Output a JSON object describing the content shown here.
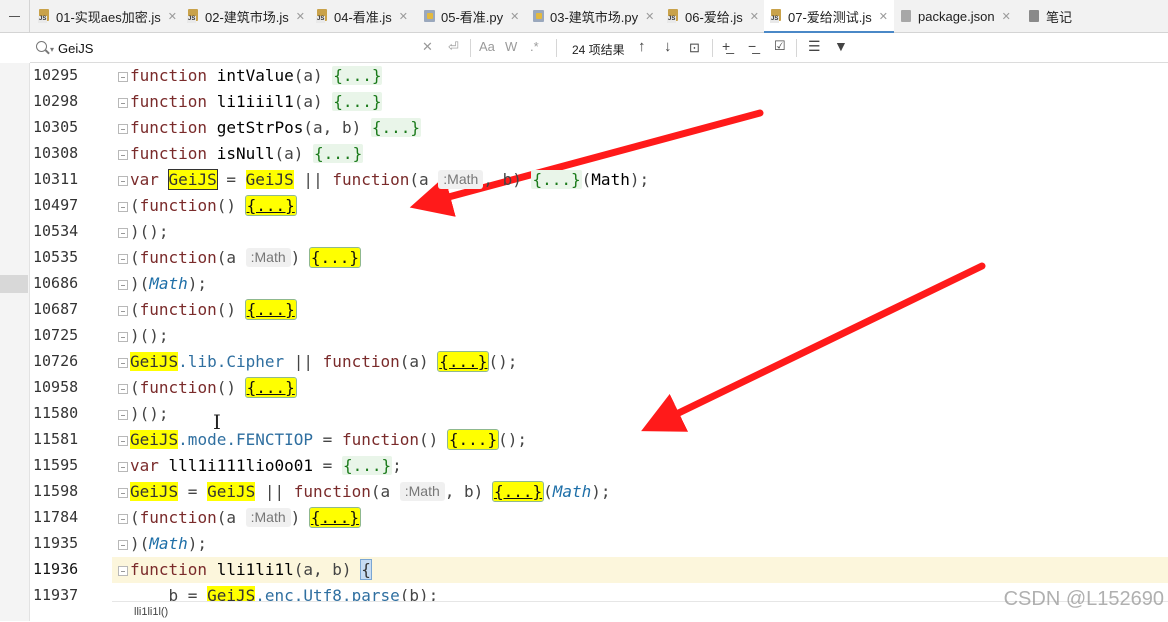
{
  "tabs": [
    {
      "label": "01-实现aes加密.js",
      "type": "js",
      "active": false
    },
    {
      "label": "02-建筑市场.js",
      "type": "js",
      "active": false
    },
    {
      "label": "04-看准.js",
      "type": "js",
      "active": false
    },
    {
      "label": "05-看准.py",
      "type": "py",
      "active": false
    },
    {
      "label": "03-建筑市场.py",
      "type": "py",
      "active": false
    },
    {
      "label": "06-爱给.js",
      "type": "js",
      "active": false
    },
    {
      "label": "07-爱给测试.js",
      "type": "js",
      "active": true
    },
    {
      "label": "package.json",
      "type": "json",
      "active": false
    },
    {
      "label": "笔记",
      "type": "note",
      "active": false
    }
  ],
  "search": {
    "value": "GeiJS",
    "match_case_label": "Aa",
    "whole_words_label": "W",
    "regex_label": ".*",
    "match_count": "24 项结果"
  },
  "lines": [
    {
      "num": "10295",
      "tokens": [
        [
          "kw2",
          "function"
        ],
        [
          "t",
          " "
        ],
        [
          "fn",
          "intValue"
        ],
        [
          "punc",
          "(a) "
        ],
        [
          "collapsed",
          "{...}"
        ]
      ]
    },
    {
      "num": "10298",
      "tokens": [
        [
          "kw2",
          "function"
        ],
        [
          "t",
          " "
        ],
        [
          "fn",
          "li1iiil1"
        ],
        [
          "punc",
          "(a) "
        ],
        [
          "collapsed",
          "{...}"
        ]
      ]
    },
    {
      "num": "10305",
      "tokens": [
        [
          "kw2",
          "function"
        ],
        [
          "t",
          " "
        ],
        [
          "fn",
          "getStrPos"
        ],
        [
          "punc",
          "(a, b) "
        ],
        [
          "collapsed",
          "{...}"
        ]
      ]
    },
    {
      "num": "10308",
      "tokens": [
        [
          "kw2",
          "function"
        ],
        [
          "t",
          " "
        ],
        [
          "fn",
          "isNull"
        ],
        [
          "punc",
          "(a) "
        ],
        [
          "collapsed",
          "{...}"
        ]
      ]
    },
    {
      "num": "10311",
      "tokens": [
        [
          "kw2",
          "var"
        ],
        [
          "t",
          " "
        ],
        [
          "hl-box",
          "GeiJS"
        ],
        [
          "punc",
          " = "
        ],
        [
          "hl",
          "GeiJS"
        ],
        [
          "punc",
          " || "
        ],
        [
          "kw2",
          "function"
        ],
        [
          "punc",
          "(a "
        ],
        [
          "hint",
          ":Math"
        ],
        [
          "punc",
          ", b) "
        ],
        [
          "collapsed",
          "{...}"
        ],
        [
          "punc",
          "("
        ],
        [
          "fn",
          "Math"
        ],
        [
          "punc",
          ");"
        ]
      ]
    },
    {
      "num": "10497",
      "tokens": [
        [
          "punc",
          "("
        ],
        [
          "kw2",
          "function"
        ],
        [
          "punc",
          "() "
        ],
        [
          "collapsed hl-u",
          "{...}"
        ]
      ]
    },
    {
      "num": "10534",
      "tokens": [
        [
          "punc",
          ")();"
        ]
      ]
    },
    {
      "num": "10535",
      "tokens": [
        [
          "punc",
          "("
        ],
        [
          "kw2",
          "function"
        ],
        [
          "punc",
          "(a "
        ],
        [
          "hint",
          ":Math"
        ],
        [
          "punc",
          ") "
        ],
        [
          "collapsed hl",
          "{...}"
        ]
      ]
    },
    {
      "num": "10686",
      "tokens": [
        [
          "punc",
          ")("
        ],
        [
          "type",
          "Math"
        ],
        [
          "punc",
          ");"
        ]
      ]
    },
    {
      "num": "10687",
      "tokens": [
        [
          "punc",
          "("
        ],
        [
          "kw2",
          "function"
        ],
        [
          "punc",
          "() "
        ],
        [
          "collapsed hl-u",
          "{...}"
        ]
      ]
    },
    {
      "num": "10725",
      "tokens": [
        [
          "punc",
          ")();"
        ]
      ]
    },
    {
      "num": "10726",
      "tokens": [
        [
          "hl",
          "GeiJS"
        ],
        [
          "prop",
          ".lib.Cipher"
        ],
        [
          "punc",
          " || "
        ],
        [
          "kw2",
          "function"
        ],
        [
          "punc",
          "(a) "
        ],
        [
          "collapsed hl-u",
          "{...}"
        ],
        [
          "punc",
          "();"
        ]
      ]
    },
    {
      "num": "10958",
      "tokens": [
        [
          "punc",
          "("
        ],
        [
          "kw2",
          "function"
        ],
        [
          "punc",
          "() "
        ],
        [
          "collapsed hl-u",
          "{...}"
        ]
      ]
    },
    {
      "num": "11580",
      "tokens": [
        [
          "punc",
          ")();"
        ]
      ]
    },
    {
      "num": "11581",
      "tokens": [
        [
          "hl",
          "GeiJS"
        ],
        [
          "prop",
          ".mode.FENCTIOP"
        ],
        [
          "punc",
          " = "
        ],
        [
          "kw2",
          "function"
        ],
        [
          "punc",
          "() "
        ],
        [
          "collapsed hl",
          "{...}"
        ],
        [
          "punc",
          "();"
        ]
      ]
    },
    {
      "num": "11595",
      "tokens": [
        [
          "kw2",
          "var"
        ],
        [
          "t",
          " "
        ],
        [
          "fn",
          "lll1i111lio0o01"
        ],
        [
          "punc",
          " = "
        ],
        [
          "collapsed",
          "{...}"
        ],
        [
          "punc",
          ";"
        ]
      ]
    },
    {
      "num": "11598",
      "tokens": [
        [
          "hl",
          "GeiJS"
        ],
        [
          "punc",
          " = "
        ],
        [
          "hl",
          "GeiJS"
        ],
        [
          "punc",
          " || "
        ],
        [
          "kw2",
          "function"
        ],
        [
          "punc",
          "(a "
        ],
        [
          "hint",
          ":Math"
        ],
        [
          "punc",
          ", b) "
        ],
        [
          "collapsed hl-u",
          "{...}"
        ],
        [
          "punc",
          "("
        ],
        [
          "type",
          "Math"
        ],
        [
          "punc",
          ");"
        ]
      ]
    },
    {
      "num": "11784",
      "tokens": [
        [
          "punc",
          "("
        ],
        [
          "kw2",
          "function"
        ],
        [
          "punc",
          "(a "
        ],
        [
          "hint",
          ":Math"
        ],
        [
          "punc",
          ") "
        ],
        [
          "collapsed hl-u",
          "{...}"
        ]
      ]
    },
    {
      "num": "11935",
      "tokens": [
        [
          "punc",
          ")("
        ],
        [
          "type",
          "Math"
        ],
        [
          "punc",
          ");"
        ]
      ]
    },
    {
      "num": "11936",
      "tokens": [
        [
          "kw2",
          "function"
        ],
        [
          "t",
          " "
        ],
        [
          "fn",
          "lli1li1l"
        ],
        [
          "punc",
          "(a, b) "
        ],
        [
          "bracket-hl",
          "{"
        ]
      ]
    },
    {
      "num": "11937",
      "tokens": [
        [
          "punc",
          "    b = "
        ],
        [
          "hl",
          "GeiJS"
        ],
        [
          "prop",
          ".enc.Utf8.parse"
        ],
        [
          "punc",
          "(b);"
        ]
      ]
    }
  ],
  "breadcrumb": "lli1li1l()",
  "watermark": "CSDN @L152690"
}
